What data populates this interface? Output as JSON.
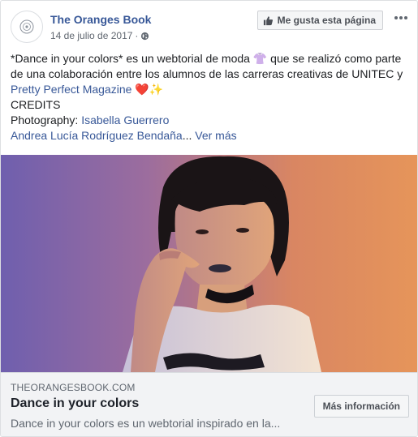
{
  "header": {
    "page_name": "The Oranges Book",
    "date": "14 de julio de 2017",
    "separator": "·",
    "like_button": "Me gusta esta página"
  },
  "post": {
    "line1_pre": "*Dance in your colors* es un webtorial de moda ",
    "emoji_shirt": "👚",
    "line1_post": " que se realizó como parte de una colaboración entre los alumnos de las carreras creativas de UNITEC y ",
    "mention": "Pretty Perfect Magazine",
    "emoji_heart": "❤️",
    "emoji_sparkles": "✨",
    "credits_label": "CREDITS",
    "photography_label": "Photography:",
    "photographer": "Isabella Guerrero",
    "credit_2": "Andrea Lucía Rodríguez Bendaña",
    "ellipsis": "...",
    "see_more": "Ver más"
  },
  "preview": {
    "domain": "THEORANGESBOOK.COM",
    "title": "Dance in your colors",
    "description": "Dance in your colors es un webtorial inspirado en la...",
    "button": "Más información"
  },
  "icons": {
    "avatar": "oranges-book-logo-icon",
    "privacy": "globe-icon",
    "like": "thumbs-up-icon",
    "more": "more-options-icon"
  },
  "colors": {
    "link": "#385898",
    "text": "#1c1e21",
    "secondary": "#606770",
    "preview_bg": "#f2f3f5"
  }
}
